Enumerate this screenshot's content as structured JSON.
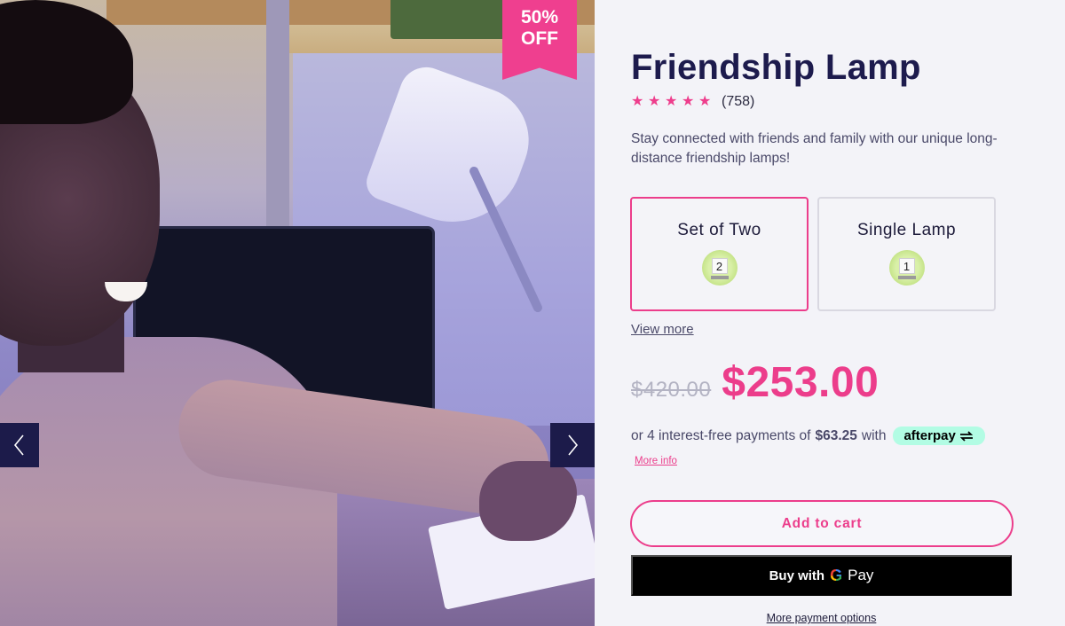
{
  "gallery": {
    "badge_line1": "50%",
    "badge_line2": "OFF",
    "prev_icon": "chevron-left-icon",
    "next_icon": "chevron-right-icon"
  },
  "product": {
    "title": "Friendship Lamp",
    "rating_stars": 5,
    "review_count": "(758)",
    "description": "Stay connected with friends and family with our unique long-distance friendship lamps!"
  },
  "variants": [
    {
      "label": "Set of Two",
      "icon_number": "2",
      "selected": true
    },
    {
      "label": "Single Lamp",
      "icon_number": "1",
      "selected": false
    }
  ],
  "view_more": "View more",
  "price": {
    "old": "$420.00",
    "new": "$253.00"
  },
  "afterpay": {
    "prefix": "or 4 interest-free payments of",
    "amount": "$63.25",
    "suffix": "with",
    "brand": "afterpay",
    "more_info": "More info"
  },
  "actions": {
    "add_to_cart": "Add to cart",
    "buy_with": "Buy with",
    "gpay_g": "G",
    "gpay_pay": "Pay",
    "more_payment_options": "More payment options"
  },
  "colors": {
    "accent": "#ec3d8b",
    "title": "#1d1b4d",
    "nav_bg": "#1c1b4a",
    "afterpay_bg": "#b2fce4"
  }
}
